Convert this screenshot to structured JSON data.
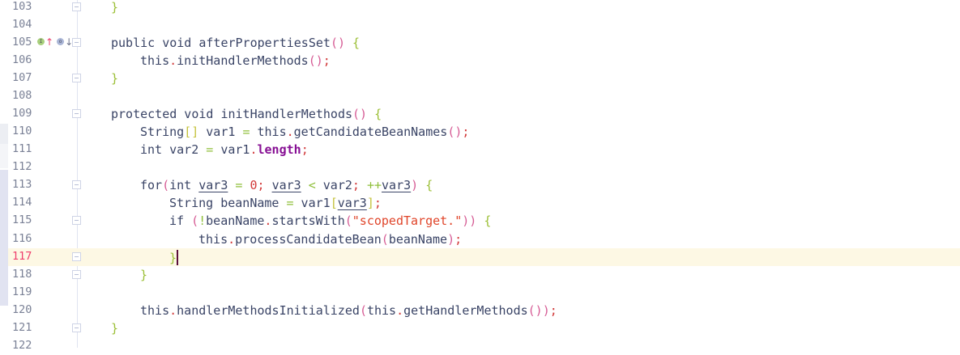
{
  "editor": {
    "current_line": 117,
    "gutter_icons_line_105": [
      "implementing-method-icon",
      "overridden-method-icon"
    ],
    "lines": [
      {
        "num": "103",
        "indent": 1,
        "fold": true,
        "tokens": [
          {
            "t": "}",
            "c": "b"
          }
        ]
      },
      {
        "num": "104",
        "indent": 0,
        "fold": false,
        "tokens": []
      },
      {
        "num": "105",
        "indent": 1,
        "fold": true,
        "tokens": [
          {
            "t": "public void afterPropertiesSet"
          },
          {
            "t": "()",
            "c": "p"
          },
          {
            "t": " "
          },
          {
            "t": "{",
            "c": "b"
          }
        ]
      },
      {
        "num": "106",
        "indent": 2,
        "fold": false,
        "tokens": [
          {
            "t": "this"
          },
          {
            "t": ".",
            "c": "s"
          },
          {
            "t": "initHandlerMethods"
          },
          {
            "t": "()",
            "c": "p"
          },
          {
            "t": ";",
            "c": "s"
          }
        ]
      },
      {
        "num": "107",
        "indent": 1,
        "fold": true,
        "tokens": [
          {
            "t": "}",
            "c": "b"
          }
        ]
      },
      {
        "num": "108",
        "indent": 0,
        "fold": false,
        "tokens": []
      },
      {
        "num": "109",
        "indent": 1,
        "fold": true,
        "tokens": [
          {
            "t": "protected void initHandlerMethods"
          },
          {
            "t": "()",
            "c": "p"
          },
          {
            "t": " "
          },
          {
            "t": "{",
            "c": "b"
          }
        ]
      },
      {
        "num": "110",
        "indent": 2,
        "fold": false,
        "tokens": [
          {
            "t": "String"
          },
          {
            "t": "[]",
            "c": "br"
          },
          {
            "t": " var1 "
          },
          {
            "t": "=",
            "c": "o"
          },
          {
            "t": " this"
          },
          {
            "t": ".",
            "c": "s"
          },
          {
            "t": "getCandidateBeanNames"
          },
          {
            "t": "()",
            "c": "p"
          },
          {
            "t": ";",
            "c": "s"
          }
        ]
      },
      {
        "num": "111",
        "indent": 2,
        "fold": false,
        "tokens": [
          {
            "t": "int var2 "
          },
          {
            "t": "=",
            "c": "o"
          },
          {
            "t": " var1"
          },
          {
            "t": ".",
            "c": "s"
          },
          {
            "t": "length",
            "c": "f"
          },
          {
            "t": ";",
            "c": "s"
          }
        ]
      },
      {
        "num": "112",
        "indent": 0,
        "fold": false,
        "tokens": []
      },
      {
        "num": "113",
        "indent": 2,
        "fold": true,
        "tokens": [
          {
            "t": "for"
          },
          {
            "t": "(",
            "c": "p"
          },
          {
            "t": "int "
          },
          {
            "t": "var3",
            "c": "u"
          },
          {
            "t": " "
          },
          {
            "t": "=",
            "c": "o"
          },
          {
            "t": " "
          },
          {
            "t": "0",
            "c": "n"
          },
          {
            "t": ";",
            "c": "s"
          },
          {
            "t": " "
          },
          {
            "t": "var3",
            "c": "u"
          },
          {
            "t": " "
          },
          {
            "t": "<",
            "c": "o"
          },
          {
            "t": " var2"
          },
          {
            "t": ";",
            "c": "s"
          },
          {
            "t": " "
          },
          {
            "t": "++",
            "c": "o"
          },
          {
            "t": "var3",
            "c": "u"
          },
          {
            "t": ")",
            "c": "p"
          },
          {
            "t": " "
          },
          {
            "t": "{",
            "c": "b"
          }
        ]
      },
      {
        "num": "114",
        "indent": 3,
        "fold": false,
        "tokens": [
          {
            "t": "String beanName "
          },
          {
            "t": "=",
            "c": "o"
          },
          {
            "t": " var1"
          },
          {
            "t": "[",
            "c": "br"
          },
          {
            "t": "var3",
            "c": "u"
          },
          {
            "t": "]",
            "c": "br"
          },
          {
            "t": ";",
            "c": "s"
          }
        ]
      },
      {
        "num": "115",
        "indent": 3,
        "fold": true,
        "tokens": [
          {
            "t": "if "
          },
          {
            "t": "(",
            "c": "p"
          },
          {
            "t": "!",
            "c": "o"
          },
          {
            "t": "beanName"
          },
          {
            "t": ".",
            "c": "s"
          },
          {
            "t": "startsWith"
          },
          {
            "t": "(",
            "c": "p"
          },
          {
            "t": "\"scopedTarget.\"",
            "c": "str"
          },
          {
            "t": "))",
            "c": "p"
          },
          {
            "t": " "
          },
          {
            "t": "{",
            "c": "b"
          }
        ]
      },
      {
        "num": "116",
        "indent": 4,
        "fold": false,
        "tokens": [
          {
            "t": "this"
          },
          {
            "t": ".",
            "c": "s"
          },
          {
            "t": "processCandidateBean"
          },
          {
            "t": "(",
            "c": "p"
          },
          {
            "t": "beanName"
          },
          {
            "t": ")",
            "c": "p"
          },
          {
            "t": ";",
            "c": "s"
          }
        ]
      },
      {
        "num": "117",
        "indent": 3,
        "fold": true,
        "caret": true,
        "tokens": [
          {
            "t": "}",
            "c": "b"
          }
        ]
      },
      {
        "num": "118",
        "indent": 2,
        "fold": true,
        "tokens": [
          {
            "t": "}",
            "c": "b"
          }
        ]
      },
      {
        "num": "119",
        "indent": 0,
        "fold": false,
        "tokens": []
      },
      {
        "num": "120",
        "indent": 2,
        "fold": false,
        "tokens": [
          {
            "t": "this"
          },
          {
            "t": ".",
            "c": "s"
          },
          {
            "t": "handlerMethodsInitialized"
          },
          {
            "t": "(",
            "c": "p"
          },
          {
            "t": "this"
          },
          {
            "t": ".",
            "c": "s"
          },
          {
            "t": "getHandlerMethods"
          },
          {
            "t": "())",
            "c": "p"
          },
          {
            "t": ";",
            "c": "s"
          }
        ]
      },
      {
        "num": "121",
        "indent": 1,
        "fold": true,
        "tokens": [
          {
            "t": "}",
            "c": "b"
          }
        ]
      },
      {
        "num": "122",
        "indent": 0,
        "fold": false,
        "tokens": []
      }
    ]
  }
}
